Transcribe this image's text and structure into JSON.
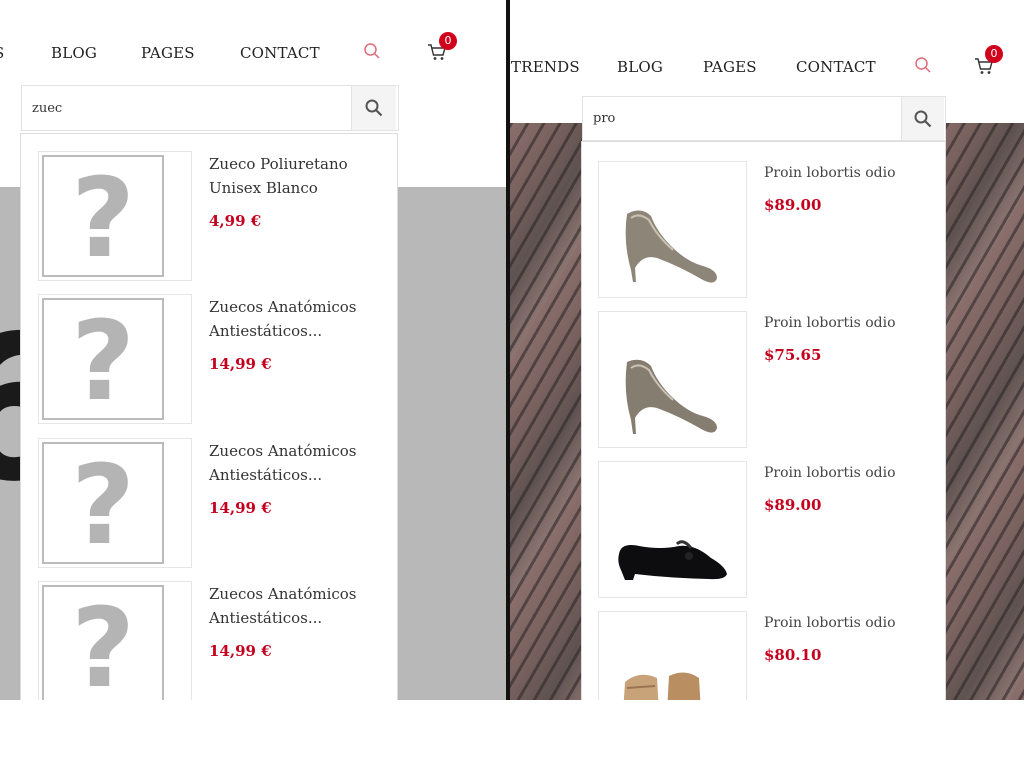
{
  "left": {
    "nav": [
      "BLOG",
      "PAGES",
      "CONTACT"
    ],
    "nav_partial": "S",
    "cart_count": "0",
    "search": {
      "value": "zuec",
      "placeholder": ""
    },
    "results": [
      {
        "name_line1": "Zueco Poliuretano",
        "name_line2": "Unisex Blanco",
        "price": "4,99 €"
      },
      {
        "name_line1": "Zuecos Anatómicos",
        "name_line2": "Antiestáticos...",
        "price": "14,99 €"
      },
      {
        "name_line1": "Zuecos Anatómicos",
        "name_line2": "Antiestáticos...",
        "price": "14,99 €"
      },
      {
        "name_line1": "Zuecos Anatómicos",
        "name_line2": "Antiestáticos...",
        "price": "14,99 €"
      }
    ],
    "placeholder_glyph": "?"
  },
  "right": {
    "nav": [
      "TRENDS",
      "BLOG",
      "PAGES",
      "CONTACT"
    ],
    "cart_count": "0",
    "search": {
      "value": "pro",
      "placeholder": ""
    },
    "results": [
      {
        "name": "Proin lobortis odio",
        "price": "$89.00",
        "image": "metallic-pump"
      },
      {
        "name": "Proin lobortis odio",
        "price": "$75.65",
        "image": "metallic-pump"
      },
      {
        "name": "Proin lobortis odio",
        "price": "$89.00",
        "image": "black-loafer"
      },
      {
        "name": "Proin lobortis odio",
        "price": "$80.10",
        "image": "tan-boot"
      }
    ]
  },
  "colors": {
    "accent_price": "#c4001d",
    "badge": "#d0021b",
    "search_icon": "#e06c78"
  },
  "icons": [
    "search-icon",
    "cart-icon",
    "magnifier-icon",
    "question-mark-icon",
    "shoe-image"
  ]
}
